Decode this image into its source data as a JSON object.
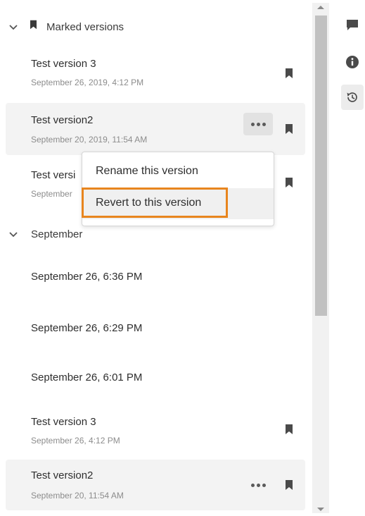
{
  "sections": {
    "marked": {
      "label": "Marked versions"
    },
    "september": {
      "label": "September"
    }
  },
  "marked_items": [
    {
      "title": "Test version 3",
      "date": "September 26, 2019, 4:12 PM"
    },
    {
      "title": "Test version2",
      "date": "September 20, 2019, 11:54 AM"
    },
    {
      "title": "Test versi",
      "date": "September"
    }
  ],
  "context_menu": {
    "items": [
      {
        "label": "Rename this version"
      },
      {
        "label": "Revert to this version"
      }
    ]
  },
  "september_items": [
    {
      "title": "September 26, 6:36 PM"
    },
    {
      "title": "September 26, 6:29 PM"
    },
    {
      "title": "September 26, 6:01 PM"
    },
    {
      "title": "Test version 3",
      "date": "September 26, 4:12 PM"
    },
    {
      "title": "Test version2",
      "date": "September 20, 11:54 AM"
    }
  ],
  "right_rail": [
    "comment-icon",
    "info-icon",
    "history-icon"
  ],
  "colors": {
    "highlight": "#e8851e",
    "selected_row": "#f3f3f3"
  }
}
